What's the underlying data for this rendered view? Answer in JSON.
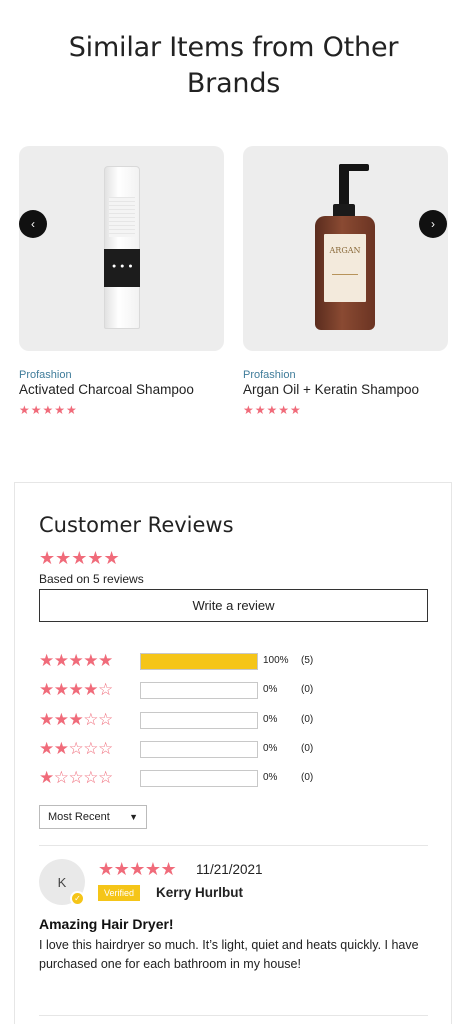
{
  "similar": {
    "title_line1": "Similar Items from Other",
    "title_line2": "Brands",
    "products": [
      {
        "brand": "Profashion",
        "name": "Activated Charcoal Shampoo",
        "stars": "★★★★★",
        "rating": 5
      },
      {
        "brand": "Profashion",
        "name": "Argan Oil + Keratin Shampoo",
        "stars": "★★★★★",
        "rating": 5
      }
    ],
    "arrow_left_icon": "‹",
    "arrow_right_icon": "›"
  },
  "reviews": {
    "title": "Customer Reviews",
    "average_stars": "★★★★★",
    "average_rating": 5,
    "based_on": "Based on 5 reviews",
    "write_review_label": "Write a review",
    "histogram": [
      {
        "stars": 5,
        "filled": "★★★★★",
        "empty": "",
        "percent_label": "100%",
        "count_label": "(5)",
        "fraction": 1.0
      },
      {
        "stars": 4,
        "filled": "★★★★",
        "empty": "☆",
        "percent_label": "0%",
        "count_label": "(0)",
        "fraction": 0
      },
      {
        "stars": 3,
        "filled": "★★★",
        "empty": "☆☆",
        "percent_label": "0%",
        "count_label": "(0)",
        "fraction": 0
      },
      {
        "stars": 2,
        "filled": "★★",
        "empty": "☆☆☆",
        "percent_label": "0%",
        "count_label": "(0)",
        "fraction": 0
      },
      {
        "stars": 1,
        "filled": "★",
        "empty": "☆☆☆☆",
        "percent_label": "0%",
        "count_label": "(0)",
        "fraction": 0
      }
    ],
    "sort": {
      "selected": "Most Recent"
    },
    "items": [
      {
        "avatar_initial": "K",
        "stars": "★★★★★",
        "rating": 5,
        "date": "11/21/2021",
        "verified_label": "Verified",
        "author": "Kerry Hurlbut",
        "headline": "Amazing Hair Dryer!",
        "body": "I love this hairdryer so much. It’s light, quiet and heats quickly. I have purchased one for each bathroom in my house!"
      }
    ]
  },
  "colors": {
    "star": "#f06b7a",
    "bar_fill": "#f5c518",
    "brand_link": "#3f7c9a",
    "verified": "#f5c518"
  }
}
